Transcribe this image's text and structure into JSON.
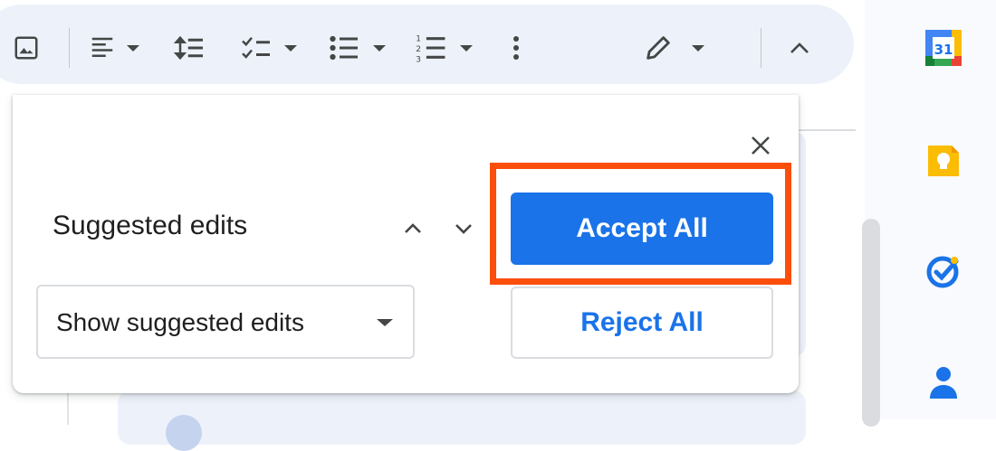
{
  "toolbar": {
    "icons": [
      "insert-image-icon",
      "align-icon",
      "line-spacing-icon",
      "checklist-icon",
      "bulleted-list-icon",
      "numbered-list-icon",
      "more-options-icon",
      "editing-mode-icon",
      "collapse-toolbar-icon"
    ]
  },
  "popup": {
    "title": "Suggested edits",
    "accept_all_label": "Accept All",
    "reject_all_label": "Reject All",
    "view_mode": {
      "selected": "Show suggested edits"
    },
    "highlight_color": "#fb4e0b",
    "accent_color": "#1a73e8"
  },
  "side_panel": {
    "calendar_day": "31",
    "apps": [
      "calendar-icon",
      "keep-icon",
      "tasks-icon",
      "contacts-icon"
    ]
  }
}
